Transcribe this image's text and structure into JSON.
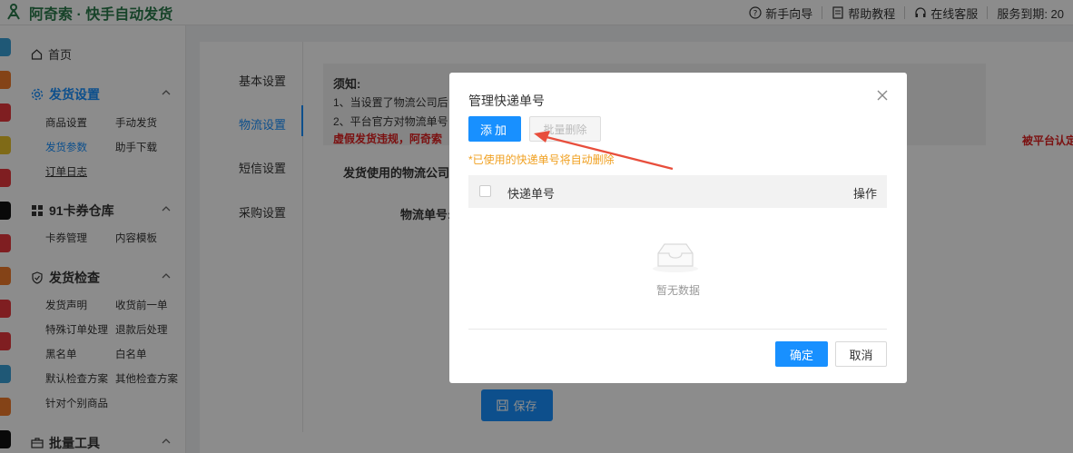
{
  "header": {
    "brand": "阿奇索 · 快手自动发货",
    "links": [
      "新手向导",
      "帮助教程",
      "在线客服"
    ],
    "service_label": "服务到期: 20"
  },
  "sidebar": {
    "home": "首页",
    "sections": [
      {
        "title": "发货设置",
        "items": [
          "商品设置",
          "手动发货",
          "发货参数",
          "助手下载",
          "订单日志"
        ]
      },
      {
        "title": "91卡券仓库",
        "items": [
          "卡券管理",
          "内容模板"
        ]
      },
      {
        "title": "发货检查",
        "items": [
          "发货声明",
          "收货前一单",
          "特殊订单处理",
          "退款后处理",
          "黑名单",
          "白名单",
          "默认检查方案",
          "其他检查方案",
          "针对个别商品"
        ]
      },
      {
        "title": "批量工具",
        "items": []
      }
    ]
  },
  "main": {
    "tabs": [
      "基本设置",
      "物流设置",
      "短信设置",
      "采购设置"
    ],
    "notice": {
      "title": "须知:",
      "line1": "1、当设置了物流公司后",
      "line2": "2、平台官方对物流单号",
      "line3": "虚假发货违规，阿奇索",
      "line_right": "被平台认定为"
    },
    "labels": {
      "logistics_company": "发货使用的物流公司:",
      "tracking_number": "物流单号:"
    },
    "save_label": "保存"
  },
  "modal": {
    "title": "管理快递单号",
    "add_label": "添加",
    "batch_delete_label": "批量删除",
    "hint": "*已使用的快递单号将自动删除",
    "table": {
      "columns": [
        "快递单号",
        "操作"
      ],
      "rows": []
    },
    "empty_text": "暂无数据",
    "ok_label": "确定",
    "cancel_label": "取消"
  },
  "colors": {
    "primary": "#1890ff",
    "brand_green": "#2a7a4b",
    "warning_red": "#e02020",
    "hint_orange": "#f0a020",
    "annotation_arrow": "#e84e3c"
  }
}
